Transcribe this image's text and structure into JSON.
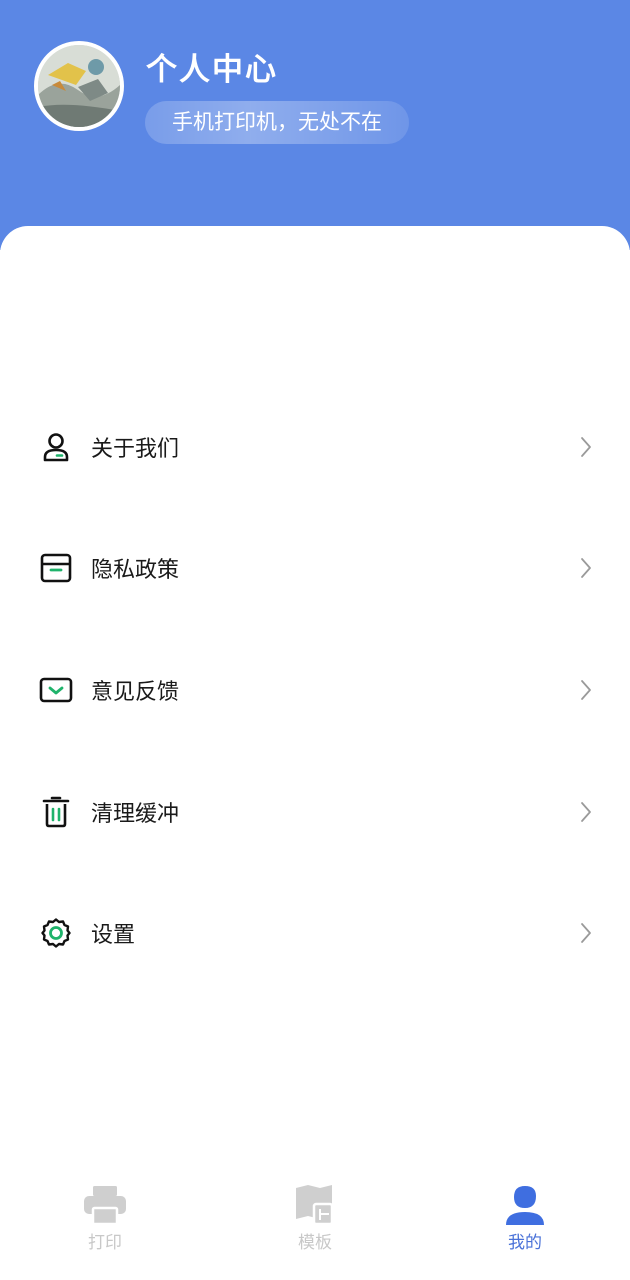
{
  "header": {
    "title": "个人中心",
    "slogan": "手机打印机，无处不在",
    "background_color": "#5b87e5"
  },
  "menu": {
    "items": [
      {
        "label": "关于我们",
        "icon": "user-icon"
      },
      {
        "label": "隐私政策",
        "icon": "box-icon"
      },
      {
        "label": "意见反馈",
        "icon": "mail-icon"
      },
      {
        "label": "清理缓冲",
        "icon": "trash-icon"
      },
      {
        "label": "设置",
        "icon": "settings-gear-icon"
      }
    ],
    "accent_color": "#1fb36b"
  },
  "tabbar": {
    "tabs": [
      {
        "label": "打印",
        "icon": "printer-icon",
        "active": false
      },
      {
        "label": "模板",
        "icon": "template-icon",
        "active": false
      },
      {
        "label": "我的",
        "icon": "profile-icon",
        "active": true
      }
    ],
    "active_color": "#4a72d8",
    "inactive_color": "#c8c8c8"
  }
}
